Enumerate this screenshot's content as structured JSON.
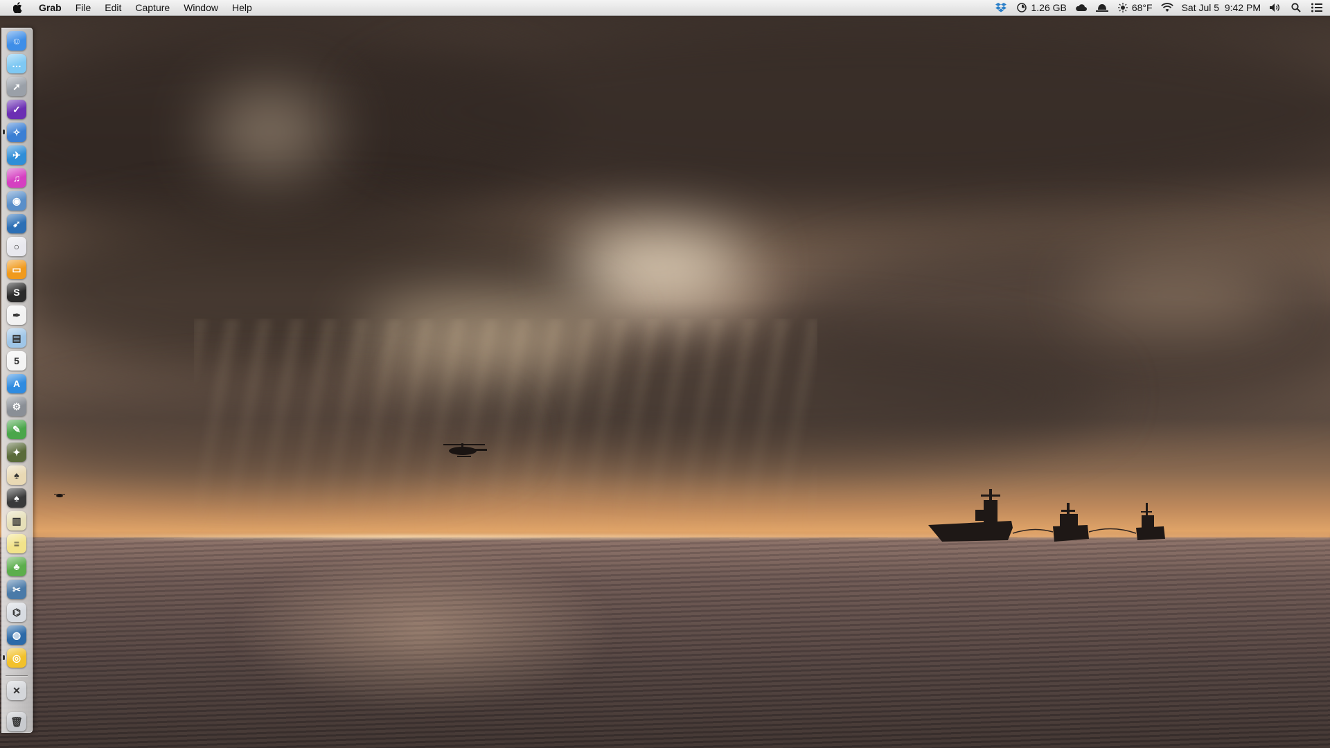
{
  "menubar": {
    "app_name": "Grab",
    "items": [
      "File",
      "Edit",
      "Capture",
      "Window",
      "Help"
    ],
    "status": {
      "memory": "1.26 GB",
      "temperature": "68°F",
      "datetime": "Sat Jul 5  9:42 PM"
    },
    "icons": [
      "dropbox-icon",
      "memory-gauge-icon",
      "cloud-icon",
      "hat-icon",
      "sun-icon",
      "wifi-icon",
      "volume-icon",
      "spotlight-search-icon",
      "notification-center-icon"
    ]
  },
  "dock": {
    "items": [
      {
        "name": "finder",
        "color": "#3e8ee8",
        "glyph": "☺"
      },
      {
        "name": "messages",
        "color": "#7ec8f3",
        "glyph": "…"
      },
      {
        "name": "launchpad",
        "color": "#9aa0a8",
        "glyph": "➚"
      },
      {
        "name": "omnifocus",
        "color": "#6b2fb3",
        "glyph": "✓"
      },
      {
        "name": "safari",
        "color": "#3b7fd4",
        "glyph": "✧"
      },
      {
        "name": "twitterrific",
        "color": "#2f8ed8",
        "glyph": "✈"
      },
      {
        "name": "itunes",
        "color": "#d53fc1",
        "glyph": "♫"
      },
      {
        "name": "tweetbot",
        "color": "#5a8fc9",
        "glyph": "◉"
      },
      {
        "name": "birdie",
        "color": "#2c6fb5",
        "glyph": "➹"
      },
      {
        "name": "dashboard",
        "color": "#e8e8ee",
        "glyph": "○"
      },
      {
        "name": "ibooks",
        "color": "#f09a1c",
        "glyph": "▭"
      },
      {
        "name": "scrivener",
        "color": "#2a2a2a",
        "glyph": "S"
      },
      {
        "name": "ink-pen-app",
        "color": "#f2f2f2",
        "glyph": "✒"
      },
      {
        "name": "preview",
        "color": "#9fc6e8",
        "glyph": "▤"
      },
      {
        "name": "calendar",
        "color": "#f4f4f4",
        "glyph": "5"
      },
      {
        "name": "app-store",
        "color": "#2f8be0",
        "glyph": "A"
      },
      {
        "name": "system-preferences",
        "color": "#8a8f96",
        "glyph": "⚙"
      },
      {
        "name": "evernote",
        "color": "#4aa64a",
        "glyph": "✎"
      },
      {
        "name": "photo-app",
        "color": "#5a6b3a",
        "glyph": "✦"
      },
      {
        "name": "sketch-pad",
        "color": "#e9d9b4",
        "glyph": "♠"
      },
      {
        "name": "solitaire",
        "color": "#3a3a3a",
        "glyph": "♠"
      },
      {
        "name": "notefile",
        "color": "#e6dfb8",
        "glyph": "▥"
      },
      {
        "name": "notes",
        "color": "#f2e38a",
        "glyph": "≡"
      },
      {
        "name": "clean-app",
        "color": "#5cae4c",
        "glyph": "♣"
      },
      {
        "name": "image-capture",
        "color": "#4a7aa8",
        "glyph": "✂"
      },
      {
        "name": "network-utility",
        "color": "#d8dce2",
        "glyph": "⌬"
      },
      {
        "name": "globe-app",
        "color": "#2c6aa8",
        "glyph": "◍"
      },
      {
        "name": "yellow-ring-app",
        "color": "#f2c12a",
        "glyph": "◎"
      },
      {
        "name": "documents-folder",
        "color": "#d4d6da",
        "glyph": "✕"
      },
      {
        "name": "trash",
        "color": "#c8cace",
        "glyph": "🗑"
      }
    ]
  },
  "colors": {
    "menubar_bg": "#e6e6e6",
    "sky_dark": "#3b302a",
    "horizon_glow": "#e0a468",
    "sea": "#4e403e"
  }
}
